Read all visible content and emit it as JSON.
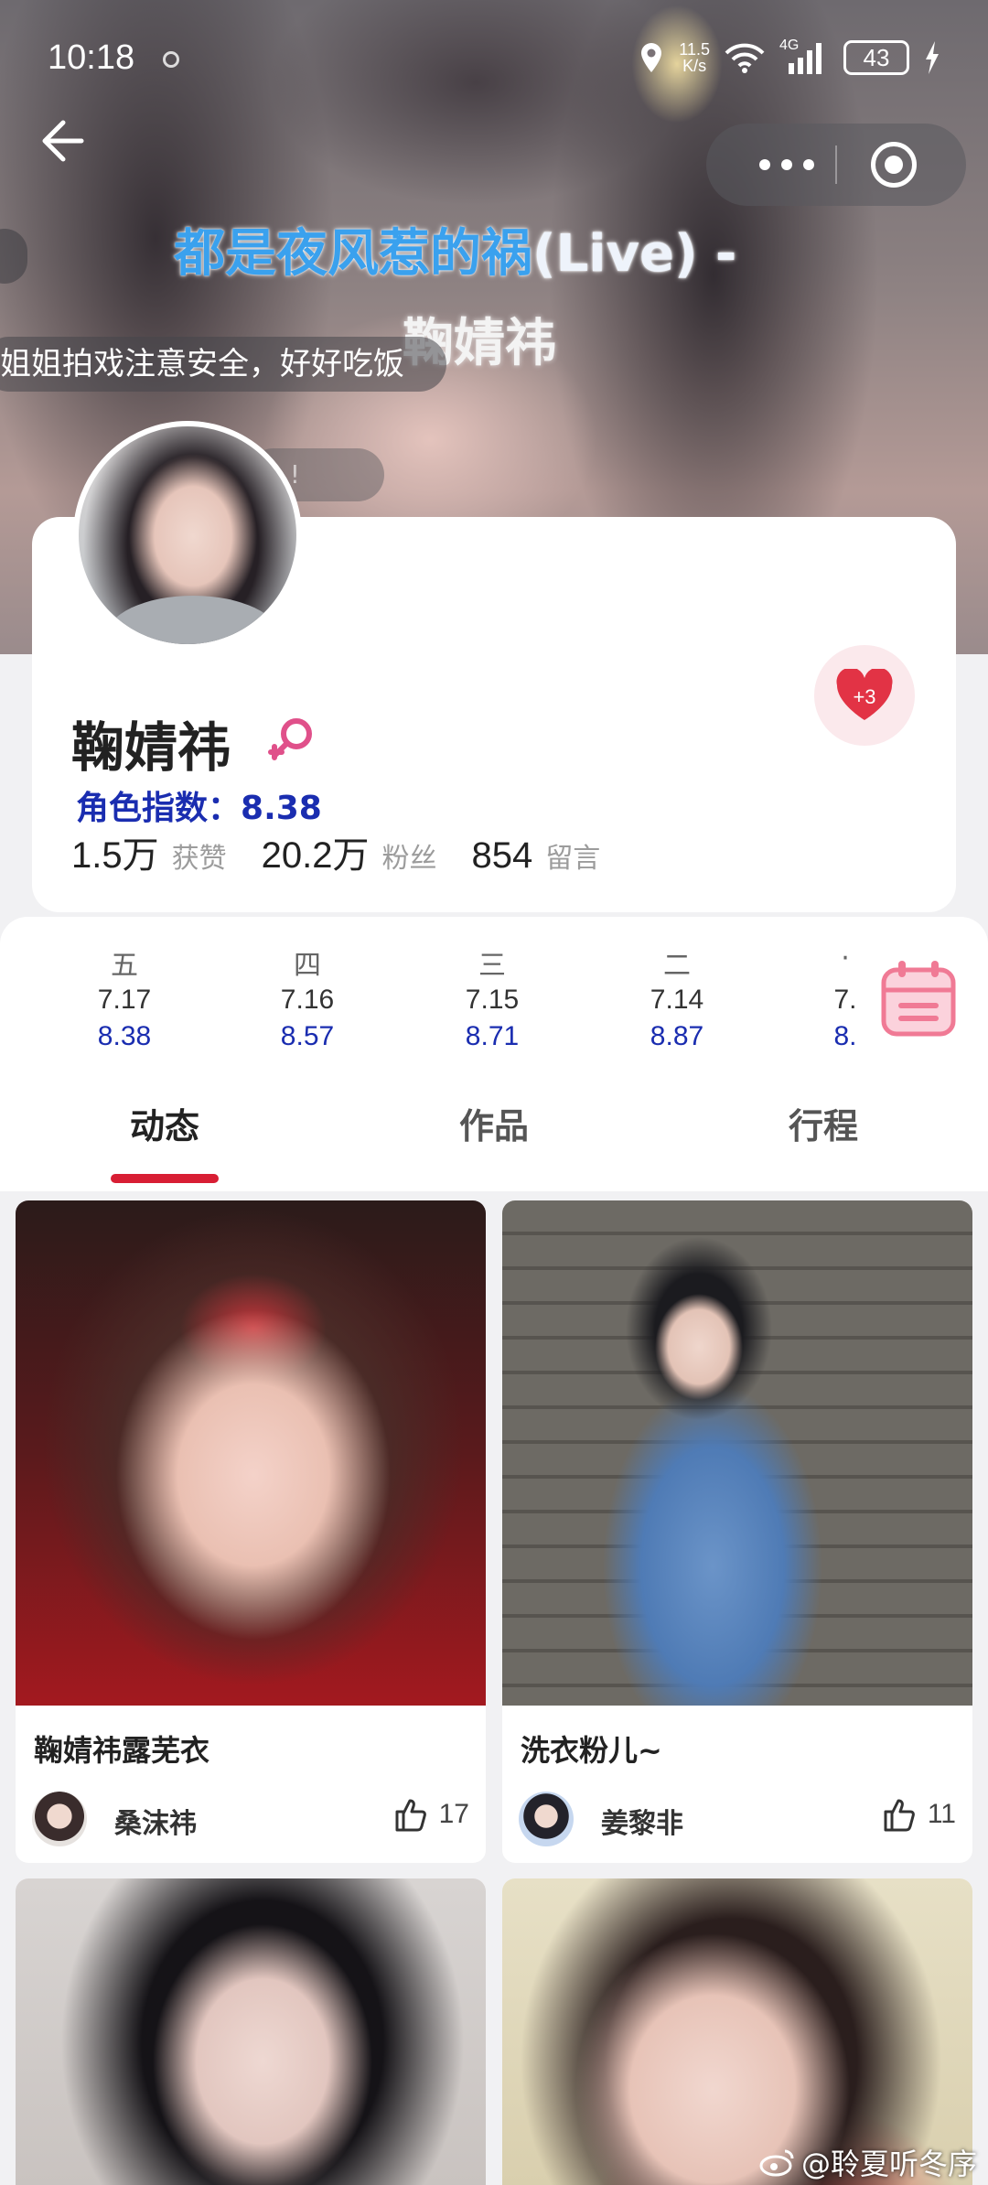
{
  "status_bar": {
    "time": "10:18",
    "net_speed_value": "11.5",
    "net_speed_unit": "K/s",
    "network": "4G",
    "battery": "43"
  },
  "hero": {
    "lyric_main": "都是夜风惹的祸",
    "lyric_tail": "(Live) -",
    "lyric_artist": "鞠婧祎",
    "danmu": "姐姐拍戏注意安全，好好吃饭",
    "danmu_partial": "...!"
  },
  "profile": {
    "name": "鞠婧祎",
    "gender": "female",
    "role_index_label": "角色指数：",
    "role_index_value": "8.38",
    "like_badge": "+3",
    "stats": [
      {
        "value": "1.5万",
        "label": "获赞"
      },
      {
        "value": "20.2万",
        "label": "粉丝"
      },
      {
        "value": "854",
        "label": "留言"
      }
    ]
  },
  "daily_scores": [
    {
      "weekday": "五",
      "date": "7.17",
      "score": "8.38"
    },
    {
      "weekday": "四",
      "date": "7.16",
      "score": "8.57"
    },
    {
      "weekday": "三",
      "date": "7.15",
      "score": "8.71"
    },
    {
      "weekday": "二",
      "date": "7.14",
      "score": "8.87"
    },
    {
      "weekday": "·",
      "date": "7.",
      "score": "8."
    }
  ],
  "tabs": [
    {
      "label": "动态",
      "active": true
    },
    {
      "label": "作品",
      "active": false
    },
    {
      "label": "行程",
      "active": false
    }
  ],
  "feed": [
    {
      "title": "鞠婧祎露芜衣",
      "author": "桑沫祎",
      "likes": "17"
    },
    {
      "title": "洗衣粉儿~",
      "author": "姜黎非",
      "likes": "11"
    }
  ],
  "watermark": "@聆夏听冬序",
  "colors": {
    "accent_red": "#d81e34",
    "index_blue": "#1a2db0",
    "lyric_blue": "#3aa1ee",
    "calendar_pink": "#f07a95"
  }
}
